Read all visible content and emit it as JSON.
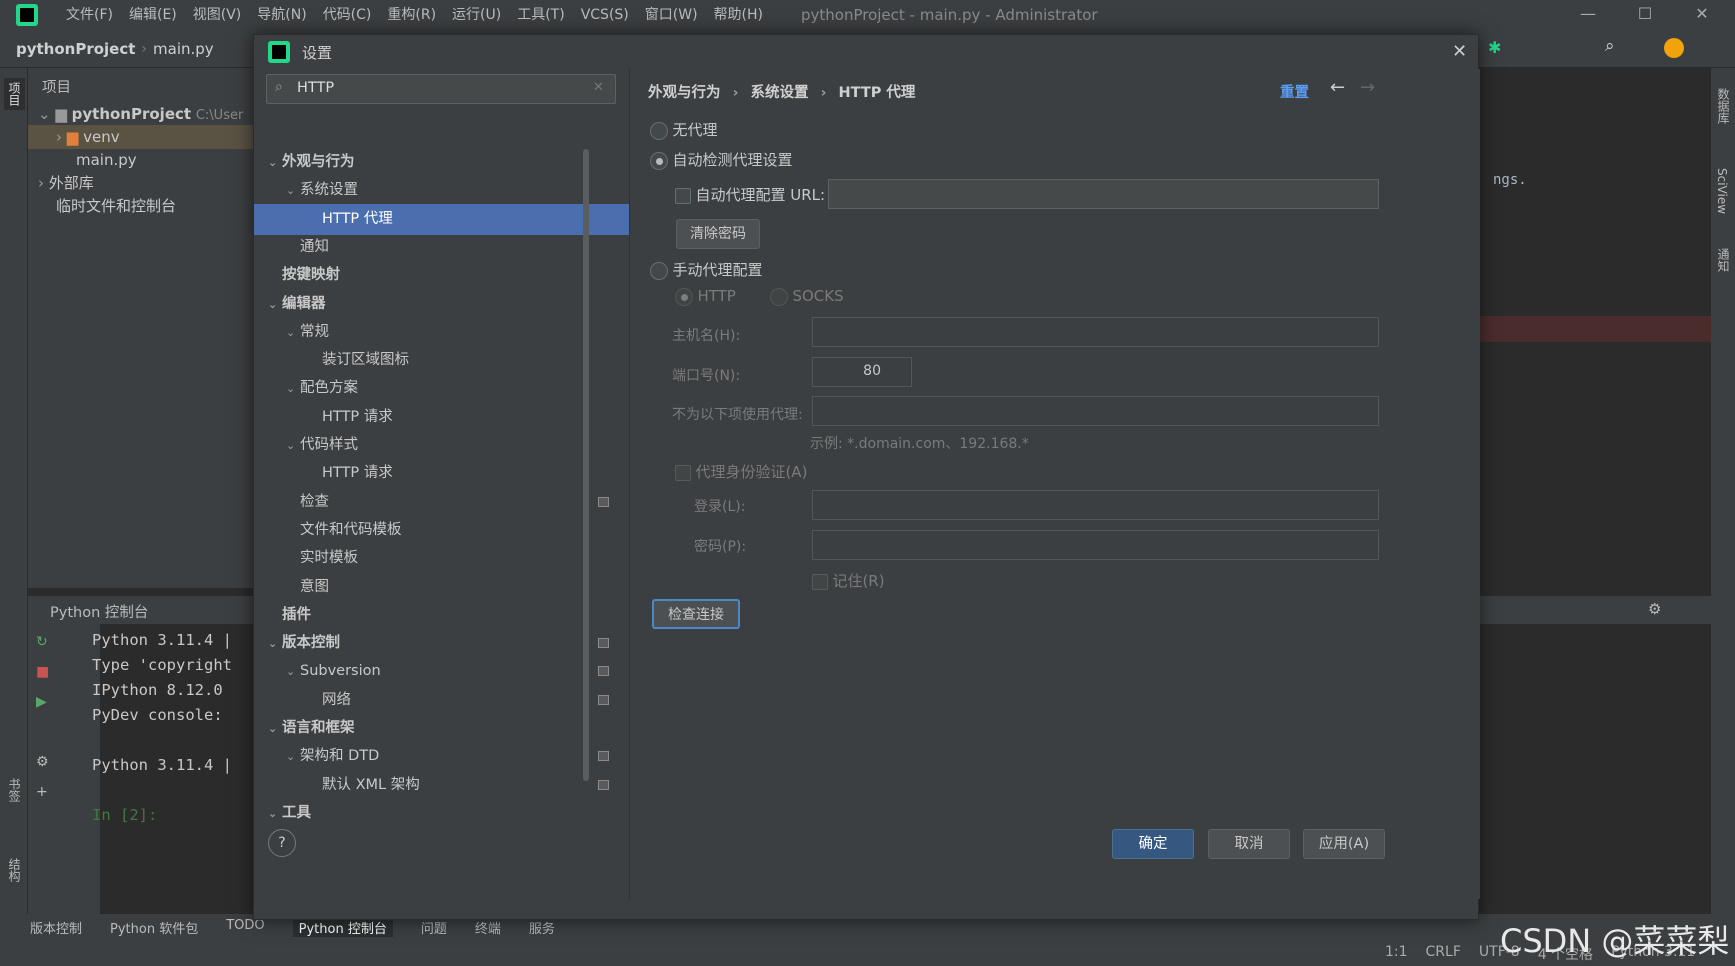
{
  "titlebar": {
    "menus": [
      "文件(F)",
      "编辑(E)",
      "视图(V)",
      "导航(N)",
      "代码(C)",
      "重构(R)",
      "运行(U)",
      "工具(T)",
      "VCS(S)",
      "窗口(W)",
      "帮助(H)"
    ],
    "title": "pythonProject - main.py - Administrator"
  },
  "navbar": {
    "project": "pythonProject",
    "file": "main.py"
  },
  "project_panel": {
    "header": "项目",
    "root": "pythonProject",
    "root_path": "C:\\User",
    "items": [
      "venv",
      "main.py",
      "外部库",
      "临时文件和控制台"
    ]
  },
  "left_tools": {
    "project": "项目",
    "bookmarks": "书签",
    "structure": "结构"
  },
  "right_tools": {
    "database": "数据库",
    "sciview": "SciView",
    "notifications": "通知"
  },
  "editor": {
    "snippet": "ngs."
  },
  "console": {
    "tab": "Python 控制台",
    "lines": [
      "Python 3.11.4 |",
      "Type 'copyright",
      "IPython 8.12.0",
      "PyDev console: ",
      "",
      "Python 3.11.4 |",
      "",
      "In [2]:"
    ]
  },
  "bottom_tools": [
    "版本控制",
    "Python 软件包",
    "TODO",
    "Python 控制台",
    "问题",
    "终端",
    "服务"
  ],
  "status": {
    "pos": "1:1",
    "eol": "CRLF",
    "enc": "UTF-8",
    "indent": "4 个空格",
    "interp": "Python 3.11"
  },
  "watermark": "CSDN @菜菜梨",
  "dialog": {
    "title": "设置",
    "search": {
      "value": "HTTP"
    },
    "nav": [
      {
        "label": "外观与行为",
        "level": 0,
        "bold": true,
        "chev": "v"
      },
      {
        "label": "系统设置",
        "level": 1,
        "chev": "v"
      },
      {
        "label": "HTTP 代理",
        "level": 2,
        "selected": true
      },
      {
        "label": "通知",
        "level": 1
      },
      {
        "label": "按键映射",
        "level": 0,
        "bold": true
      },
      {
        "label": "编辑器",
        "level": 0,
        "bold": true,
        "chev": "v"
      },
      {
        "label": "常规",
        "level": 1,
        "chev": "v"
      },
      {
        "label": "装订区域图标",
        "level": 2
      },
      {
        "label": "配色方案",
        "level": 1,
        "chev": "v"
      },
      {
        "label": "HTTP 请求",
        "level": 2
      },
      {
        "label": "代码样式",
        "level": 1,
        "chev": "v"
      },
      {
        "label": "HTTP 请求",
        "level": 2
      },
      {
        "label": "检查",
        "level": 1,
        "gear": true
      },
      {
        "label": "文件和代码模板",
        "level": 1
      },
      {
        "label": "实时模板",
        "level": 1
      },
      {
        "label": "意图",
        "level": 1
      },
      {
        "label": "插件",
        "level": 0,
        "bold": true,
        "translate": true
      },
      {
        "label": "版本控制",
        "level": 0,
        "bold": true,
        "chev": "v",
        "gear": true
      },
      {
        "label": "Subversion",
        "level": 1,
        "chev": "v",
        "gear": true
      },
      {
        "label": "网络",
        "level": 2,
        "gear": true
      },
      {
        "label": "语言和框架",
        "level": 0,
        "bold": true,
        "chev": "v"
      },
      {
        "label": "架构和 DTD",
        "level": 1,
        "chev": "v",
        "gear": true
      },
      {
        "label": "默认 XML 架构",
        "level": 2,
        "gear": true
      },
      {
        "label": "工具",
        "level": 0,
        "bold": true,
        "chev": "v"
      }
    ],
    "breadcrumb": [
      "外观与行为",
      "系统设置",
      "HTTP 代理"
    ],
    "reset": "重置",
    "no_proxy": "无代理",
    "auto_detect": "自动检测代理设置",
    "auto_url_label": "自动代理配置 URL:",
    "auto_url_value": "",
    "clear_pw": "清除密码",
    "manual": "手动代理配置",
    "http": "HTTP",
    "socks": "SOCKS",
    "host_label": "主机名(H):",
    "host_value": "",
    "port_label": "端口号(N):",
    "port_value": "80",
    "no_proxy_for_label": "不为以下项使用代理:",
    "no_proxy_for_value": "",
    "example": "示例: *.domain.com、192.168.*",
    "proxy_auth": "代理身份验证(A)",
    "login_label": "登录(L):",
    "login_value": "",
    "password_label": "密码(P):",
    "password_value": "",
    "remember": "记住(R)",
    "check_conn": "检查连接",
    "ok": "确定",
    "cancel": "取消",
    "apply": "应用(A)",
    "help": "?"
  }
}
